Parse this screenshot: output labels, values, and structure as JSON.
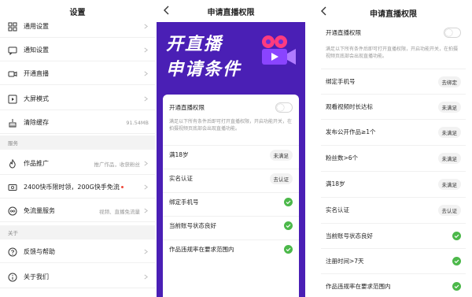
{
  "panel1": {
    "title": "设置",
    "rows": [
      {
        "label": "通用设置",
        "icon": "grid-icon"
      },
      {
        "label": "通知设置",
        "icon": "message-icon"
      },
      {
        "label": "开通直播",
        "icon": "video-icon"
      },
      {
        "label": "大屏模式",
        "icon": "play-square-icon"
      },
      {
        "label": "清除缓存",
        "value": "91.54MB",
        "icon": "broom-icon"
      }
    ],
    "section_service": "服务",
    "service_rows": [
      {
        "label": "作品推广",
        "value": "推广作品，收获粉丝",
        "icon": "flame-icon"
      },
      {
        "label": "2400快币限时领，200G快手免流",
        "icon": "coin-icon"
      },
      {
        "label": "免流量服务",
        "value": "视频、直播免流量",
        "icon": "infinity-icon"
      }
    ],
    "section_about": "关于",
    "about_rows": [
      {
        "label": "反馈与帮助",
        "icon": "help-icon"
      },
      {
        "label": "关于我们",
        "icon": "info-icon"
      }
    ]
  },
  "panel2": {
    "title": "申请直播权限",
    "hero_line1": "开直播",
    "hero_line2": "申请条件",
    "toggle_label": "开通直播权限",
    "description": "满足以下所有条件后即可打开直播权限，开启功能开关，在拍摄视频页底部会出现直播功能。",
    "conditions": [
      {
        "label": "满18岁",
        "status": "未满足",
        "done": false
      },
      {
        "label": "实名认证",
        "status": "去认证",
        "done": false
      },
      {
        "label": "绑定手机号",
        "done": true
      },
      {
        "label": "当前账号状态良好",
        "done": true
      },
      {
        "label": "作品违规率在要求范围内",
        "done": true
      }
    ]
  },
  "panel3": {
    "title": "申请直播权限",
    "toggle_label": "开通直播权限",
    "description": "满足以下所有条件后即可打开直播权限，开启功能开关，在拍摄视频页底部会出现直播功能。",
    "conditions": [
      {
        "label": "绑定手机号",
        "status": "去绑定",
        "done": false
      },
      {
        "label": "观看视频时长达标",
        "status": "未满足",
        "done": false
      },
      {
        "label": "发布公开作品≥1个",
        "status": "未满足",
        "done": false
      },
      {
        "label": "粉丝数>6个",
        "status": "未满足",
        "done": false
      },
      {
        "label": "满18岁",
        "status": "未满足",
        "done": false
      },
      {
        "label": "实名认证",
        "status": "去认证",
        "done": false
      },
      {
        "label": "当前账号状态良好",
        "done": true
      },
      {
        "label": "注册时间>7天",
        "done": true
      },
      {
        "label": "作品违规率在要求范围内",
        "done": true
      }
    ]
  },
  "colors": {
    "purple_bg": "#4a1fb5",
    "check_green": "#4cb84a",
    "accent_pink": "#ff3b7f",
    "red_dot": "#f04a3c"
  }
}
